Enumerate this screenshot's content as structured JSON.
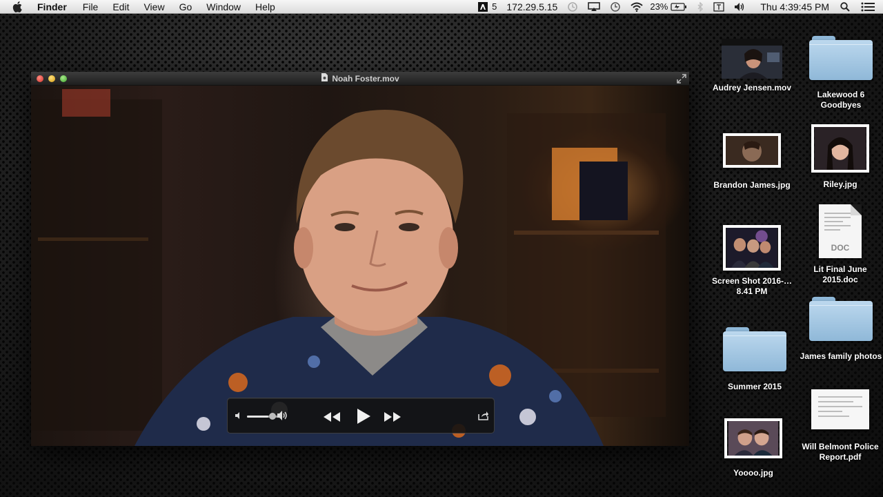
{
  "menubar": {
    "app_name": "Finder",
    "items": [
      "File",
      "Edit",
      "View",
      "Go",
      "Window",
      "Help"
    ],
    "adobe_badge": "5",
    "ip": "172.29.5.15",
    "battery_percent": "23%",
    "clock": "Thu 4:39:45 PM"
  },
  "player": {
    "title": "Noah Foster.mov",
    "volume_level": 0.65
  },
  "desktop": {
    "icons": [
      {
        "label": "Audrey Jensen.mov",
        "type": "video"
      },
      {
        "label": "Lakewood 6 Goodbyes",
        "type": "folder"
      },
      {
        "label": "Brandon James.jpg",
        "type": "photo"
      },
      {
        "label": "Riley.jpg",
        "type": "photo"
      },
      {
        "label": "Screen Shot 2016-…8.41 PM",
        "type": "photo"
      },
      {
        "label": "Lit Final June 2015.doc",
        "type": "document",
        "badge": "DOC"
      },
      {
        "label": "Summer 2015",
        "type": "folder"
      },
      {
        "label": "James family photos",
        "type": "folder"
      },
      {
        "label": "Yoooo.jpg",
        "type": "photo"
      },
      {
        "label": "Will Belmont Police Report.pdf",
        "type": "pdf"
      }
    ]
  },
  "colors": {
    "folder_blue": "#a9cbe6",
    "close": "#d2352c",
    "minimize": "#d69d14",
    "maximize": "#3ea52e"
  }
}
